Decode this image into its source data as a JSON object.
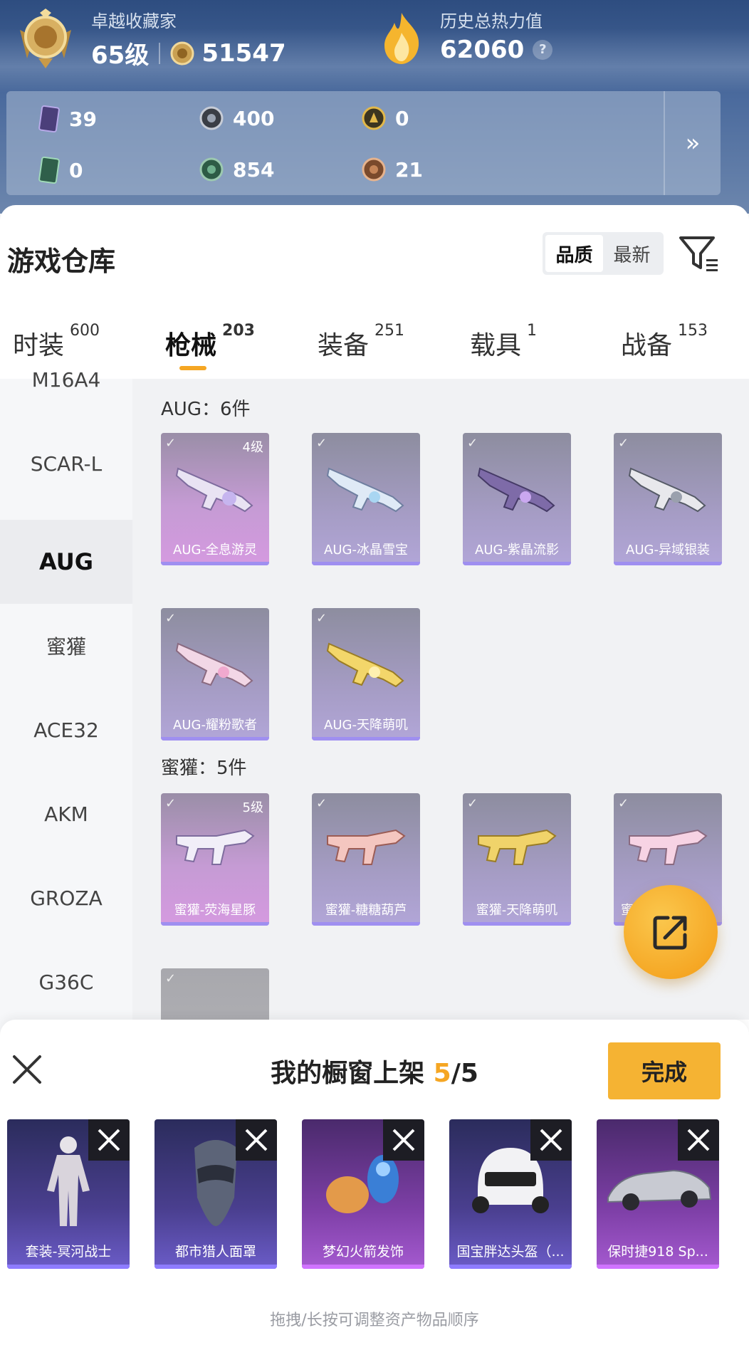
{
  "profile": {
    "title": "卓越收藏家",
    "level": "65级",
    "points": "51547",
    "heat_title": "历史总热力值",
    "heat_value": "62060",
    "heat_help": "?"
  },
  "stats": [
    "39",
    "400",
    "0",
    "0",
    "854",
    "21"
  ],
  "stats_more": "»",
  "warehouse": {
    "title": "游戏仓库",
    "sort_options": [
      "品质",
      "最新"
    ],
    "sort_selected": "品质"
  },
  "tabs": [
    {
      "label": "时装",
      "count": "600"
    },
    {
      "label": "枪械",
      "count": "203"
    },
    {
      "label": "装备",
      "count": "251"
    },
    {
      "label": "载具",
      "count": "1"
    },
    {
      "label": "战备",
      "count": "153"
    }
  ],
  "active_tab": "枪械",
  "sidebar": [
    "M16A4",
    "SCAR-L",
    "AUG",
    "蜜獾",
    "ACE32",
    "AKM",
    "GROZA",
    "G36C"
  ],
  "sidebar_selected": "AUG",
  "groups": [
    {
      "title": "AUG：6件",
      "items": [
        {
          "name": "AUG-全息游灵",
          "level": "4级",
          "rarity": "pink"
        },
        {
          "name": "AUG-冰晶雪宝",
          "level": "",
          "rarity": "purple"
        },
        {
          "name": "AUG-紫晶流影",
          "level": "",
          "rarity": "purple"
        },
        {
          "name": "AUG-异域银装",
          "level": "",
          "rarity": "purple"
        },
        {
          "name": "AUG-耀粉歌者",
          "level": "",
          "rarity": "purple"
        },
        {
          "name": "AUG-天降萌叽",
          "level": "",
          "rarity": "purple"
        }
      ]
    },
    {
      "title": "蜜獾：5件",
      "items": [
        {
          "name": "蜜獾-荧海星豚",
          "level": "5级",
          "rarity": "pink"
        },
        {
          "name": "蜜獾-糖糖葫芦",
          "level": "",
          "rarity": "purple"
        },
        {
          "name": "蜜獾-天降萌叽",
          "level": "",
          "rarity": "purple"
        },
        {
          "name": "蜜",
          "level": "",
          "rarity": "purple"
        },
        {
          "name": "",
          "level": "",
          "rarity": "gray"
        }
      ]
    }
  ],
  "check_mark": "✓",
  "showcase": {
    "title_prefix": "我的橱窗上架 ",
    "count_current": "5",
    "count_total": "/5",
    "done_label": "完成",
    "items": [
      {
        "name": "套装-冥河战士",
        "style": "blue"
      },
      {
        "name": "都市猎人面罩",
        "style": "blue"
      },
      {
        "name": "梦幻火箭发饰",
        "style": "purple"
      },
      {
        "name": "国宝胖达头盔（...",
        "style": "blue"
      },
      {
        "name": "保时捷918 Sp...",
        "style": "purple"
      }
    ],
    "hint": "拖拽/长按可调整资产物品顺序"
  },
  "colors": {
    "accent": "#f5a623",
    "done_button": "#f5b333"
  }
}
